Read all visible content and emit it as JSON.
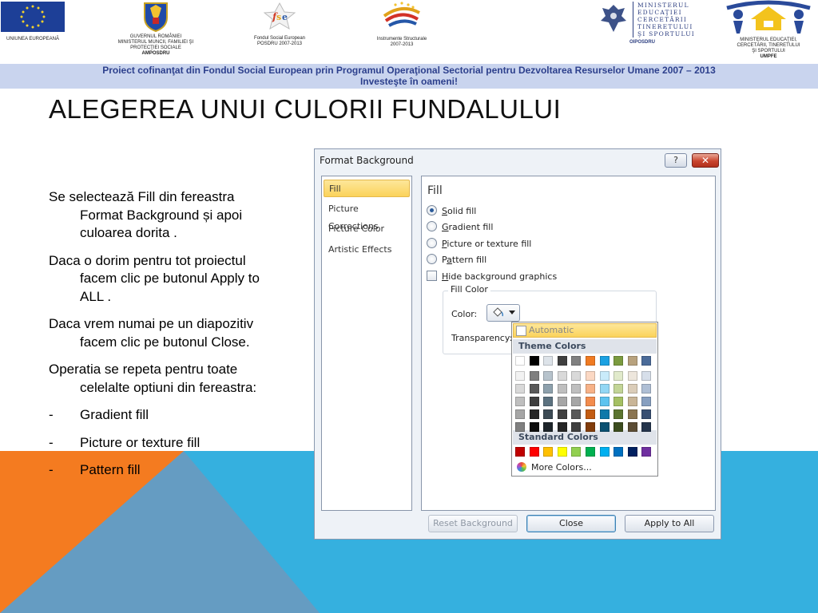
{
  "logos": {
    "eu_caption": "UNIUNEA EUROPEANĂ",
    "gov_caption": [
      "GUVERNUL ROMÂNIEI",
      "MINISTERUL MUNCII, FAMILIEI ŞI",
      "PROTECŢIEI SOCIALE"
    ],
    "gov_sub": "AMPOSDRU",
    "fse_caption": [
      "Fondul Social European",
      "POSDRU 2007-2013"
    ],
    "is_caption": [
      "Instrumente Structurale",
      "2007-2013"
    ],
    "min_wordmark": [
      "MINISTERUL",
      "EDUCAŢIEI",
      "CERCETĂRII",
      "TINERETULUI",
      "ŞI SPORTULUI"
    ],
    "min_caption": "OIPOSDRU",
    "umpfe_caption": [
      "MINISTERUL EDUCAŢIEI,",
      "CERCETĂRII, TINERETULUI",
      "ŞI SPORTULUI"
    ],
    "umpfe_sub": "UMPFE"
  },
  "banner": {
    "line1": "Proiect cofinanţat din Fondul Social European prin Programul Operaţional Sectorial pentru Dezvoltarea Resurselor Umane 2007 – 2013",
    "line2": "Investeşte în oameni!"
  },
  "slide": {
    "title": "ALEGEREA UNUI CULORII FUNDALULUI",
    "paragraphs": [
      "Se selectează Fill din fereastra Format Background și apoi culoarea dorita .",
      "Daca o dorim pentru tot proiectul facem clic pe butonul Apply to ALL .",
      "Daca vrem numai pe un diapozitiv facem clic pe butonul Close.",
      "Operatia se repeta pentru toate celelalte optiuni din fereastra:"
    ],
    "bullets": [
      "Gradient fill",
      "Picture or texture fill",
      "Pattern fill"
    ],
    "bullet_marker": "-"
  },
  "dialog": {
    "title": "Format Background",
    "help_label": "?",
    "close_label": "✕",
    "nav": [
      "Fill",
      "Picture Corrections",
      "Picture Color",
      "Artistic Effects"
    ],
    "active_nav": "Fill",
    "heading": "Fill",
    "options": [
      {
        "key": "S",
        "rest": "olid fill",
        "selected": true
      },
      {
        "key": "G",
        "rest": "radient fill",
        "selected": false
      },
      {
        "key": "P",
        "rest": "icture or texture fill",
        "selected": false
      },
      {
        "pre": "P",
        "key": "a",
        "rest": "ttern fill",
        "selected": false
      }
    ],
    "hide_graphics": {
      "key": "H",
      "rest": "ide background graphics",
      "checked": false
    },
    "fill_color_group": "Fill Color",
    "color_label": "Color:",
    "transparency_label": "Transparency:",
    "buttons": {
      "reset": "Reset Background",
      "close": "Close",
      "apply": "Apply to All"
    }
  },
  "color_dropdown": {
    "automatic": "Automatic",
    "theme_heading": "Theme Colors",
    "standard_heading": "Standard Colors",
    "more_colors": "More Colors...",
    "theme_top_row": [
      "#ffffff",
      "#000000",
      "#dde3e9",
      "#3f3f3f",
      "#808080",
      "#f07b23",
      "#1ba1e2",
      "#7b9b3f",
      "#b8a27e",
      "#4b6b99"
    ],
    "theme_shades": [
      [
        "#f2f2f2",
        "#7f7f7f",
        "#b7c3cc",
        "#d9d9d9",
        "#d9d9d9",
        "#fbd8c3",
        "#c9ebfa",
        "#e1eacb",
        "#ede6dc",
        "#d7dfea"
      ],
      [
        "#d9d9d9",
        "#595959",
        "#8ea1ad",
        "#bfbfbf",
        "#bfbfbf",
        "#f7b288",
        "#93d7f4",
        "#c3d597",
        "#dbcdb9",
        "#afbfd5"
      ],
      [
        "#bfbfbf",
        "#3f3f3f",
        "#5c7280",
        "#a6a6a6",
        "#a6a6a6",
        "#f38c4d",
        "#5dc3ef",
        "#a5c063",
        "#c9b597",
        "#879fc0"
      ],
      [
        "#a6a6a6",
        "#262626",
        "#3c4a54",
        "#404040",
        "#595959",
        "#c35c12",
        "#0f79aa",
        "#5b742f",
        "#8a7450",
        "#384f72"
      ],
      [
        "#808080",
        "#0d0d0d",
        "#1e252a",
        "#262626",
        "#3f3f3f",
        "#823d0c",
        "#0a5071",
        "#3d4d1f",
        "#5c4d35",
        "#25354c"
      ]
    ],
    "standard_colors": [
      "#c00000",
      "#ff0000",
      "#ffc000",
      "#ffff00",
      "#92d050",
      "#00b050",
      "#00b0f0",
      "#0070c0",
      "#002060",
      "#7030a0"
    ]
  }
}
